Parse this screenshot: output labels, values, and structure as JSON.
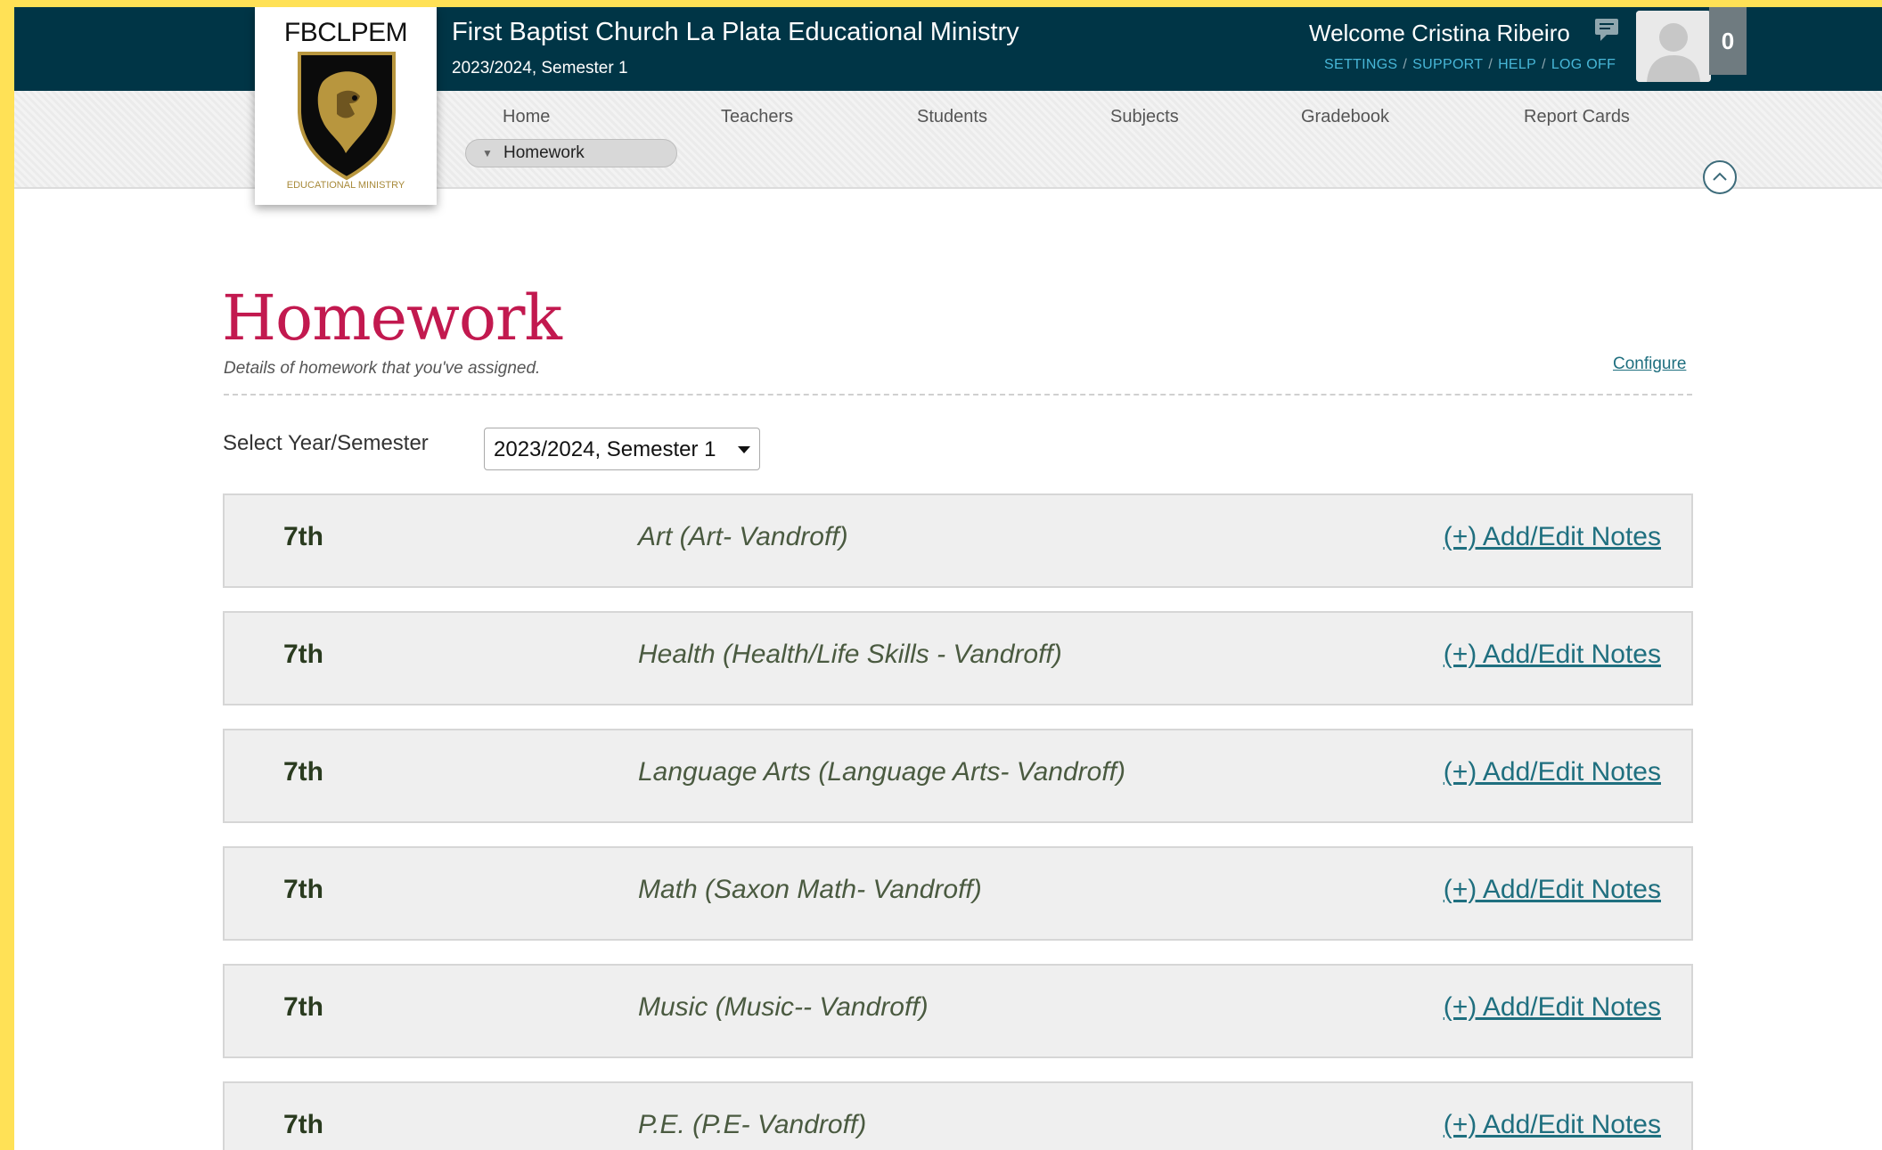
{
  "header": {
    "org_name": "First Baptist Church La Plata Educational Ministry",
    "term": "2023/2024, Semester 1",
    "welcome": "Welcome Cristina Ribeiro",
    "links": [
      "SETTINGS",
      "SUPPORT",
      "HELP",
      "LOG OFF"
    ],
    "notification_count": "0",
    "chat_icon": "chat-bubble-icon",
    "avatar_icon": "user-silhouette-icon"
  },
  "logo": {
    "abbr": "FBCLPEM",
    "sub": "EDUCATIONAL MINISTRY",
    "colors": {
      "gold": "#b8963e",
      "shield": "#0b0b0b"
    }
  },
  "nav": {
    "items": [
      "Home",
      "Teachers",
      "Students",
      "Subjects",
      "Gradebook",
      "Report Cards"
    ],
    "sub_active": "Homework"
  },
  "page": {
    "title": "Homework",
    "subtitle": "Details of homework that you've assigned.",
    "configure": "Configure"
  },
  "selector": {
    "label": "Select Year/Semester",
    "value": "2023/2024, Semester 1"
  },
  "rows": [
    {
      "grade": "7th",
      "subject": "Art (Art- Vandroff)",
      "action": "(+) Add/Edit Notes"
    },
    {
      "grade": "7th",
      "subject": "Health (Health/Life Skills - Vandroff)",
      "action": "(+) Add/Edit Notes"
    },
    {
      "grade": "7th",
      "subject": "Language Arts (Language Arts- Vandroff)",
      "action": "(+) Add/Edit Notes"
    },
    {
      "grade": "7th",
      "subject": "Math (Saxon Math- Vandroff)",
      "action": "(+) Add/Edit Notes"
    },
    {
      "grade": "7th",
      "subject": "Music (Music-- Vandroff)",
      "action": "(+) Add/Edit Notes"
    },
    {
      "grade": "7th",
      "subject": "P.E. (P.E- Vandroff)",
      "action": "(+) Add/Edit Notes"
    }
  ],
  "colors": {
    "topbar": "#003546",
    "title": "#c2194f",
    "link": "#1f6f7f",
    "util_link": "#48b7d8",
    "outer_frame": "#ffe156"
  }
}
